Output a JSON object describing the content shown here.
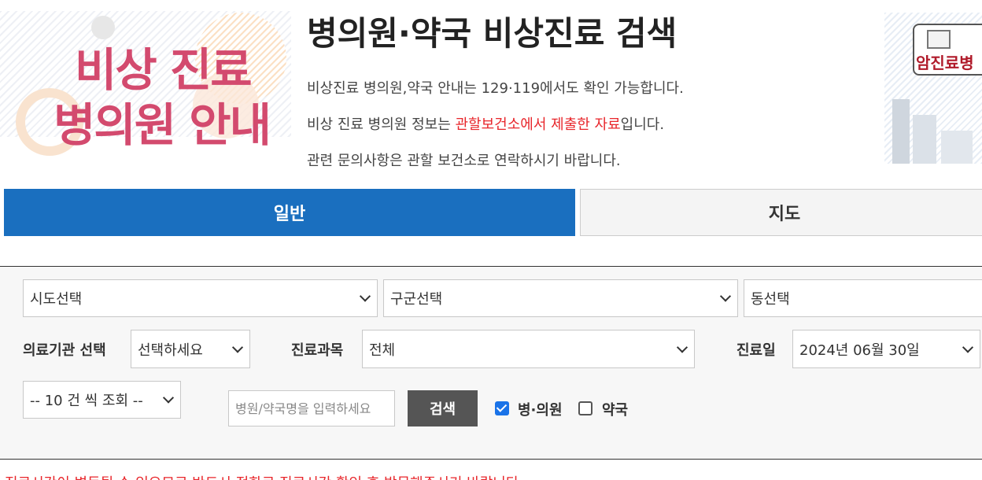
{
  "banner_left": {
    "line1": "비상 진료",
    "line2": "병의원 안내"
  },
  "header": {
    "title": "병의원·약국 비상진료 검색",
    "info_1": "비상진료 병의원,약국 안내는 129·119에서도 확인 가능합니다.",
    "info_2_before": "비상 진료 병의원 정보는 ",
    "info_2_highlight": "관할보건소에서 제출한 자료",
    "info_2_after": "입니다.",
    "info_3": "관련 문의사항은 관할 보건소로 연락하시기 바랍니다."
  },
  "banner_right": {
    "badge_text": "암진료병"
  },
  "tabs": [
    {
      "label": "일반",
      "active": true
    },
    {
      "label": "지도",
      "active": false
    }
  ],
  "search": {
    "sido": "시도선택",
    "gugun": "구군선택",
    "dong": "동선택",
    "institution_label": "의료기관 선택",
    "institution_value": "선택하세요",
    "department_label": "진료과목",
    "department_value": "전체",
    "date_label": "진료일",
    "date_value": "2024년 06월 30일",
    "page_size": "-- 10 건 씩 조회 --",
    "name_placeholder": "병원/약국명을 입력하세요",
    "search_button": "검색",
    "check_hospital": "병·의원",
    "check_hospital_checked": true,
    "check_pharmacy": "약국",
    "check_pharmacy_checked": false
  },
  "notice": "진료시간이 변동될 수 있으므로 반드시 전화로 진료시간 확인 후 방문해주시기 바랍니다.",
  "colors": {
    "accent_blue": "#1a6fbf",
    "brand_pink": "#d34a6e",
    "highlight_red": "#e8262b"
  }
}
